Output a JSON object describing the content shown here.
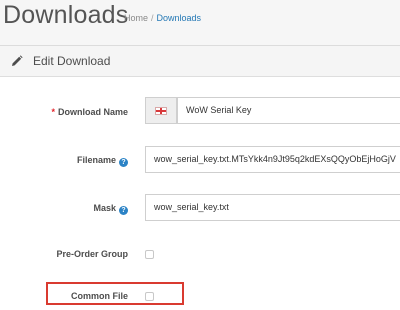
{
  "header": {
    "title": "Downloads",
    "breadcrumb": {
      "home": "Home",
      "separator": "/",
      "current": "Downloads"
    }
  },
  "panel": {
    "title": "Edit Download",
    "icon": "pencil-icon"
  },
  "form": {
    "download_name": {
      "label": "Download Name",
      "required_mark": "*",
      "value": "WoW Serial Key",
      "language_flag": "flag-icon"
    },
    "filename": {
      "label": "Filename",
      "help": "?",
      "value": "wow_serial_key.txt.MTsYkk4n9Jt95q2kdEXsQQyObEjHoGjV"
    },
    "mask": {
      "label": "Mask",
      "help": "?",
      "value": "wow_serial_key.txt"
    },
    "pre_order_group": {
      "label": "Pre-Order Group",
      "checked": false
    },
    "common_file": {
      "label": "Common File",
      "checked": false
    }
  },
  "colors": {
    "link": "#2478b5",
    "required": "#e3242b",
    "highlight": "#d93a30",
    "help_icon": "#2b83c6"
  }
}
